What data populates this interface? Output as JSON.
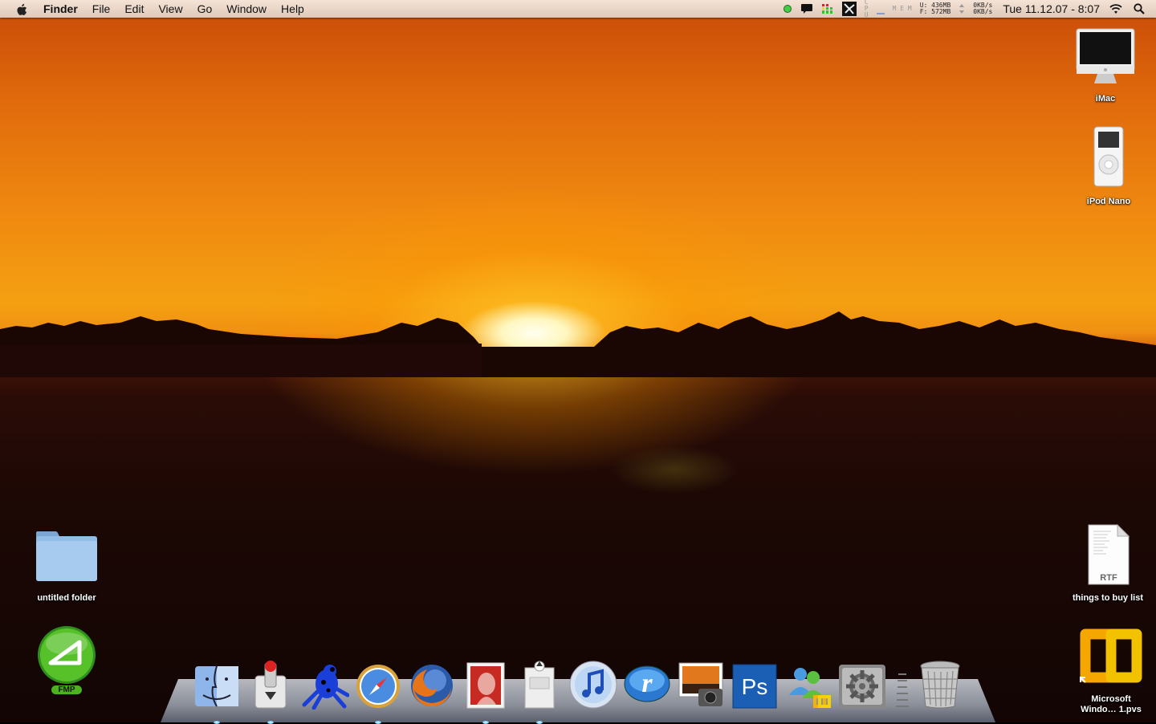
{
  "menubar": {
    "app_name": "Finder",
    "items": [
      "File",
      "Edit",
      "View",
      "Go",
      "Window",
      "Help"
    ],
    "memory_labels": [
      "U:",
      "F:"
    ],
    "memory_values": [
      "436MB",
      "572MB"
    ],
    "network_values": [
      "0KB/s",
      "0KB/s"
    ],
    "clock": "Tue 11.12.07 - 8:07",
    "icons": [
      "apple-icon",
      "status-green-icon",
      "chat-icon",
      "meter-icon",
      "activity-icon",
      "cpu-icon",
      "memory-icon",
      "network-icon",
      "wifi-icon",
      "spotlight-icon"
    ]
  },
  "desktop": {
    "imac_label": "iMac",
    "ipod_label": "iPod Nano",
    "folder_label": "untitled folder",
    "rtf_label": "things to buy list",
    "rtf_badge": "RTF",
    "fmp_label": "FMP",
    "pvs_label_line1": "Microsoft",
    "pvs_label_line2": "Windo… 1.pvs"
  },
  "dock": {
    "apps": [
      {
        "name": "Finder",
        "icon": "finder-icon",
        "running": true
      },
      {
        "name": "Transmit",
        "icon": "transmit-icon",
        "running": true
      },
      {
        "name": "Cyberduck",
        "icon": "frog-icon",
        "running": false
      },
      {
        "name": "Safari",
        "icon": "safari-icon",
        "running": true
      },
      {
        "name": "Firefox",
        "icon": "firefox-icon",
        "running": false
      },
      {
        "name": "Mail",
        "icon": "stamp-icon",
        "running": true
      },
      {
        "name": "iMac",
        "icon": "imac-dock-icon",
        "running": true
      },
      {
        "name": "iTunes",
        "icon": "itunes-icon",
        "running": false
      },
      {
        "name": "RealPlayer",
        "icon": "realplayer-icon",
        "running": false
      },
      {
        "name": "iPhoto",
        "icon": "iphoto-icon",
        "running": false
      },
      {
        "name": "Photoshop",
        "icon": "photoshop-icon",
        "running": false
      },
      {
        "name": "Messenger",
        "icon": "messenger-icon",
        "running": false
      },
      {
        "name": "System Preferences",
        "icon": "gear-icon",
        "running": false
      },
      {
        "name": "Trash",
        "icon": "trash-icon",
        "running": false
      }
    ],
    "photoshop_text": "Ps"
  },
  "colors": {
    "sky_top": "#c84a08",
    "sky_mid": "#f4a012",
    "ground": "#1c0805",
    "sun": "#fffbe0"
  }
}
